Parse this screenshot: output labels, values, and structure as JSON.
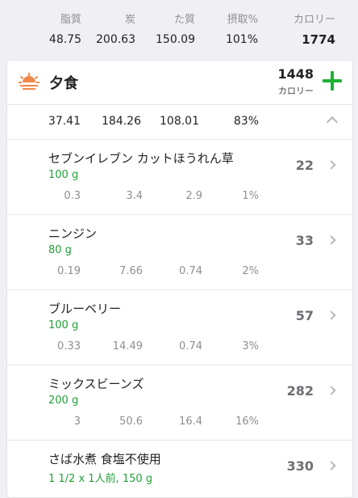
{
  "summary": {
    "fat": {
      "label": "脂質",
      "value": "48.75"
    },
    "carbs": {
      "label": "炭",
      "value": "200.63"
    },
    "protein": {
      "label": "た質",
      "value": "150.09"
    },
    "intake": {
      "label": "摂取%",
      "value": "101%"
    },
    "calories": {
      "label": "カロリー",
      "value": "1774"
    }
  },
  "meal": {
    "title": "夕食",
    "calories": "1448",
    "calories_unit": "カロリー",
    "totals": {
      "fat": "37.41",
      "carbs": "184.26",
      "protein": "108.01",
      "percent": "83%"
    },
    "items": [
      {
        "name": "セブンイレブン カットほうれん草",
        "qty": "100 g",
        "cal": "22",
        "fat": "0.3",
        "carbs": "3.4",
        "protein": "2.9",
        "percent": "1%"
      },
      {
        "name": "ニンジン",
        "qty": "80 g",
        "cal": "33",
        "fat": "0.19",
        "carbs": "7.66",
        "protein": "0.74",
        "percent": "2%"
      },
      {
        "name": "ブルーベリー",
        "qty": "100 g",
        "cal": "57",
        "fat": "0.33",
        "carbs": "14.49",
        "protein": "0.74",
        "percent": "3%"
      },
      {
        "name": "ミックスビーンズ",
        "qty": "200 g",
        "cal": "282",
        "fat": "3",
        "carbs": "50.6",
        "protein": "16.4",
        "percent": "16%"
      },
      {
        "name": "さば水煮 食塩不使用",
        "qty": "1 1/2 x 1人前, 150 g",
        "cal": "330"
      }
    ]
  },
  "colors": {
    "accent_green": "#1db134",
    "qty_green": "#21a038",
    "sun_orange": "#f0884a"
  },
  "icons": {
    "meal_icon": "sunset-icon",
    "add_icon": "plus-icon",
    "collapse_icon": "chevron-up-icon",
    "row_icon": "chevron-right-icon"
  }
}
